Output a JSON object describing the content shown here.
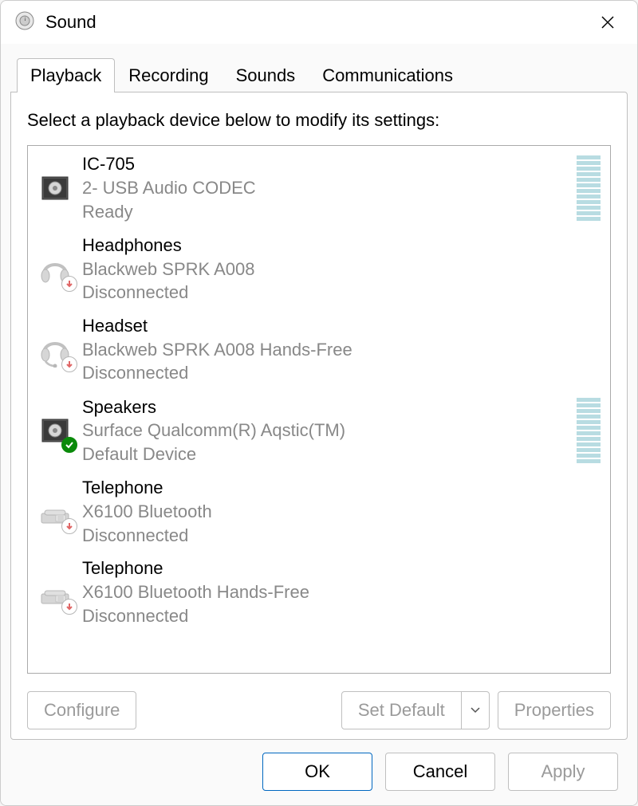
{
  "window": {
    "title": "Sound"
  },
  "tabs": [
    {
      "label": "Playback",
      "active": true
    },
    {
      "label": "Recording",
      "active": false
    },
    {
      "label": "Sounds",
      "active": false
    },
    {
      "label": "Communications",
      "active": false
    }
  ],
  "instruction": "Select a playback device below to modify its settings:",
  "devices": [
    {
      "name": "IC-705",
      "desc": "2- USB Audio CODEC",
      "status": "Ready",
      "icon": "speaker",
      "badge": null,
      "dim": false,
      "meter": true
    },
    {
      "name": "Headphones",
      "desc": "Blackweb SPRK A008",
      "status": "Disconnected",
      "icon": "headphones",
      "badge": "down",
      "dim": true,
      "meter": false
    },
    {
      "name": "Headset",
      "desc": "Blackweb SPRK A008 Hands-Free",
      "status": "Disconnected",
      "icon": "headset",
      "badge": "down",
      "dim": true,
      "meter": false
    },
    {
      "name": "Speakers",
      "desc": "Surface Qualcomm(R) Aqstic(TM)",
      "status": "Default Device",
      "icon": "speaker",
      "badge": "check",
      "dim": false,
      "meter": true
    },
    {
      "name": "Telephone",
      "desc": "X6100 Bluetooth",
      "status": "Disconnected",
      "icon": "phone",
      "badge": "down",
      "dim": true,
      "meter": false
    },
    {
      "name": "Telephone",
      "desc": "X6100 Bluetooth Hands-Free",
      "status": "Disconnected",
      "icon": "phone",
      "badge": "down",
      "dim": true,
      "meter": false
    }
  ],
  "panel_buttons": {
    "configure": "Configure",
    "set_default": "Set Default",
    "properties": "Properties"
  },
  "footer": {
    "ok": "OK",
    "cancel": "Cancel",
    "apply": "Apply"
  }
}
